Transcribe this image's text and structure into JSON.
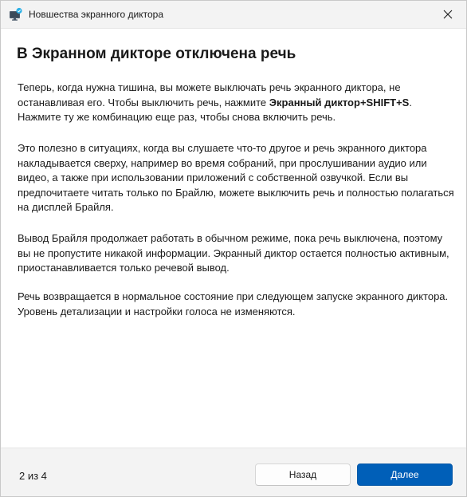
{
  "window": {
    "title": "Новшества экранного диктора"
  },
  "content": {
    "heading": "В Экранном дикторе отключена речь",
    "paragraphs": {
      "p1_before": "Теперь, когда нужна тишина, вы можете выключать речь экранного диктора, не останавливая его. Чтобы выключить речь, нажмите ",
      "p1_bold": "Экранный диктор+SHIFT+S",
      "p1_after": ". Нажмите ту же комбинацию еще раз, чтобы снова включить речь.",
      "p2": "Это полезно в ситуациях, когда вы слушаете что-то другое и речь экранного диктора накладывается сверху, например во время собраний, при прослушивании аудио или видео, а также при использовании приложений с собственной озвучкой. Если вы предпочитаете читать только по Брайлю, можете выключить речь и полностью полагаться на дисплей Брайля.",
      "p3": "Вывод Брайля продолжает работать в обычном режиме, пока речь выключена, поэтому вы не пропустите никакой информации. Экранный диктор остается полностью активным, приостанавливается только речевой вывод.",
      "p4": "Речь возвращается в нормальное состояние при следующем запуске экранного диктора. Уровень детализации и настройки голоса не изменяются."
    }
  },
  "footer": {
    "page_indicator": "2 из 4",
    "back_label": "Назад",
    "next_label": "Далее"
  },
  "icons": {
    "app": "narrator-monitor-icon",
    "close": "close-icon"
  },
  "colors": {
    "accent": "#005fb8",
    "content_bg": "#ffffff",
    "chrome_bg": "#f3f3f3"
  }
}
